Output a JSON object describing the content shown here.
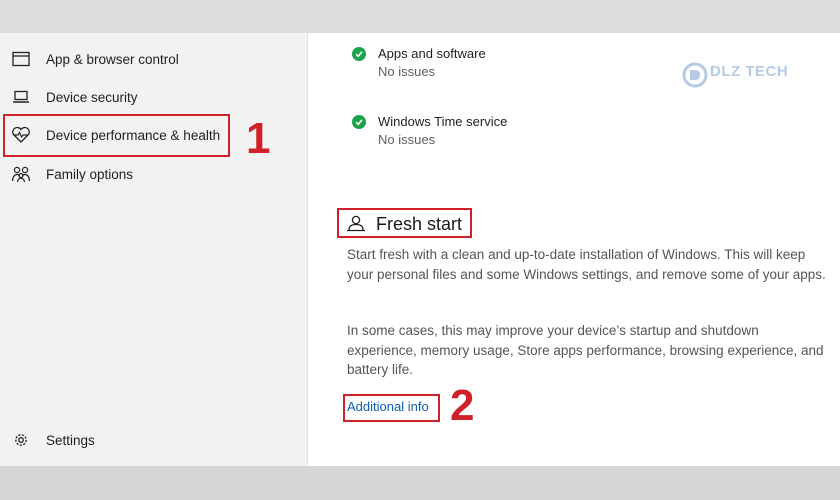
{
  "watermark": {
    "text": "DLZ TECH"
  },
  "sidebar": {
    "items": [
      {
        "label": "App & browser control",
        "icon": "browser-window-icon"
      },
      {
        "label": "Device security",
        "icon": "laptop-icon"
      },
      {
        "label": "Device performance & health",
        "icon": "heart-pulse-icon",
        "highlighted": true
      },
      {
        "label": "Family options",
        "icon": "family-icon"
      }
    ],
    "settings_label": "Settings"
  },
  "main": {
    "status_items": [
      {
        "name": "Apps and software",
        "status": "No issues"
      },
      {
        "name": "Windows Time service",
        "status": "No issues"
      }
    ],
    "fresh_start": {
      "title": "Fresh start",
      "paragraph1": "Start fresh with a clean and up-to-date installation of Windows. This will keep your personal files and some Windows settings, and remove some of your apps.",
      "paragraph2": "In some cases, this may improve your device’s startup and shutdown experience, memory usage, Store apps performance, browsing experience, and battery life.",
      "link": "Additional info"
    }
  },
  "annotations": {
    "step1": "1",
    "step2": "2",
    "color": "#d0202a"
  },
  "colors": {
    "check": "#1aa34a",
    "link": "#0b5fb3",
    "sidebar_bg": "#f2f2f2"
  }
}
